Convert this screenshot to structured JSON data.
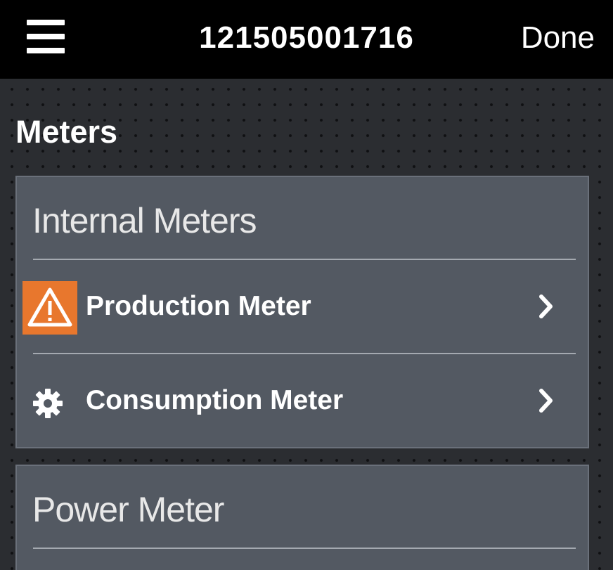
{
  "header": {
    "menu_icon": "hamburger-menu-icon",
    "title": "121505001716",
    "done_label": "Done"
  },
  "page": {
    "section_title": "Meters"
  },
  "internal_meters": {
    "heading": "Internal Meters",
    "items": [
      {
        "label": "Production Meter",
        "icon": "warning-icon",
        "accent": "#e8772d"
      },
      {
        "label": "Consumption Meter",
        "icon": "gear-icon"
      }
    ]
  },
  "power_meter": {
    "heading": "Power Meter"
  },
  "colors": {
    "topbar": "#000000",
    "card": "#535962",
    "warning": "#e8772d"
  }
}
